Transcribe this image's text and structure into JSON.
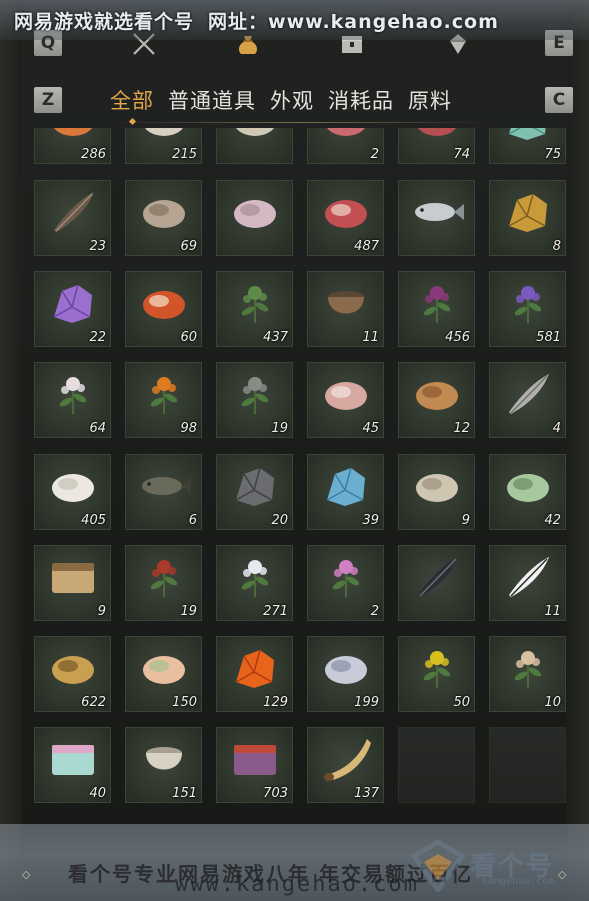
{
  "watermark_top": {
    "name": "网易游戏就选看个号",
    "site": "网址：www.kangehao.com"
  },
  "keys": {
    "left_tab": "Q",
    "right_tab": "E",
    "left_cat": "Z",
    "right_cat": "C"
  },
  "tab_icons": [
    "crossed-swords-icon",
    "pouch-icon",
    "chest-icon",
    "gem-icon"
  ],
  "active_tab_index": 1,
  "categories": [
    {
      "label": "全部",
      "active": true
    },
    {
      "label": "普通道具",
      "active": false
    },
    {
      "label": "外观",
      "active": false
    },
    {
      "label": "消耗品",
      "active": false
    },
    {
      "label": "原料",
      "active": false
    }
  ],
  "items": [
    {
      "icon": "fruit-icon",
      "qty": "286"
    },
    {
      "icon": "mushroom-icon",
      "qty": "215"
    },
    {
      "icon": "eggs-icon",
      "qty": ""
    },
    {
      "icon": "raw-meat-icon",
      "qty": "2"
    },
    {
      "icon": "meat-slab-icon",
      "qty": "74"
    },
    {
      "icon": "jade-icon",
      "qty": "75"
    },
    {
      "icon": "feathers-icon",
      "qty": "23"
    },
    {
      "icon": "hide-icon",
      "qty": "69"
    },
    {
      "icon": "sausage-icon",
      "qty": ""
    },
    {
      "icon": "beef-icon",
      "qty": "487"
    },
    {
      "icon": "fish-icon",
      "qty": ""
    },
    {
      "icon": "gold-ore-icon",
      "qty": "8"
    },
    {
      "icon": "amethyst-icon",
      "qty": "22"
    },
    {
      "icon": "agate-icon",
      "qty": "60"
    },
    {
      "icon": "herb-icon",
      "qty": "437"
    },
    {
      "icon": "mortar-icon",
      "qty": "11"
    },
    {
      "icon": "purple-flower-icon",
      "qty": "456"
    },
    {
      "icon": "lavender-icon",
      "qty": "581"
    },
    {
      "icon": "white-blossom-icon",
      "qty": "64"
    },
    {
      "icon": "orange-flower-icon",
      "qty": "98"
    },
    {
      "icon": "wheat-icon",
      "qty": "19"
    },
    {
      "icon": "paper-meat-icon",
      "qty": "45"
    },
    {
      "icon": "fur-icon",
      "qty": "12"
    },
    {
      "icon": "quills-icon",
      "qty": "4"
    },
    {
      "icon": "wool-icon",
      "qty": "405"
    },
    {
      "icon": "bass-fish-icon",
      "qty": "6"
    },
    {
      "icon": "iron-ore-icon",
      "qty": "20"
    },
    {
      "icon": "blue-crystal-icon",
      "qty": "39"
    },
    {
      "icon": "bone-icon",
      "qty": "9"
    },
    {
      "icon": "melon-icon",
      "qty": "42"
    },
    {
      "icon": "sacks-icon",
      "qty": "9"
    },
    {
      "icon": "red-twig-icon",
      "qty": "19"
    },
    {
      "icon": "chrysanthemum-icon",
      "qty": "271"
    },
    {
      "icon": "pink-aster-icon",
      "qty": "2"
    },
    {
      "icon": "black-feather-icon",
      "qty": ""
    },
    {
      "icon": "fox-tail-icon",
      "qty": "11"
    },
    {
      "icon": "golden-shell-icon",
      "qty": "622"
    },
    {
      "icon": "candy-cubes-icon",
      "qty": "150"
    },
    {
      "icon": "orange-gem-icon",
      "qty": "129"
    },
    {
      "icon": "silver-burst-icon",
      "qty": "199"
    },
    {
      "icon": "yellow-herb-icon",
      "qty": "50"
    },
    {
      "icon": "ginseng-icon",
      "qty": "10"
    },
    {
      "icon": "gift-box-icon",
      "qty": "40"
    },
    {
      "icon": "ceramic-jar-icon",
      "qty": "151"
    },
    {
      "icon": "paint-box-icon",
      "qty": "703"
    },
    {
      "icon": "horn-icon",
      "qty": "137"
    },
    {
      "icon": "",
      "qty": ""
    },
    {
      "icon": "",
      "qty": ""
    }
  ],
  "watermark_bottom": {
    "slogan": "看个号专业网易游戏八年 年交易额过百亿",
    "url": "www.kangehao.com",
    "logo_text": "看个号",
    "logo_sub": "kangehao.com"
  },
  "colors": {
    "accent": "#e3a54a",
    "cell": "#2f362c",
    "text": "#e5e2da"
  }
}
